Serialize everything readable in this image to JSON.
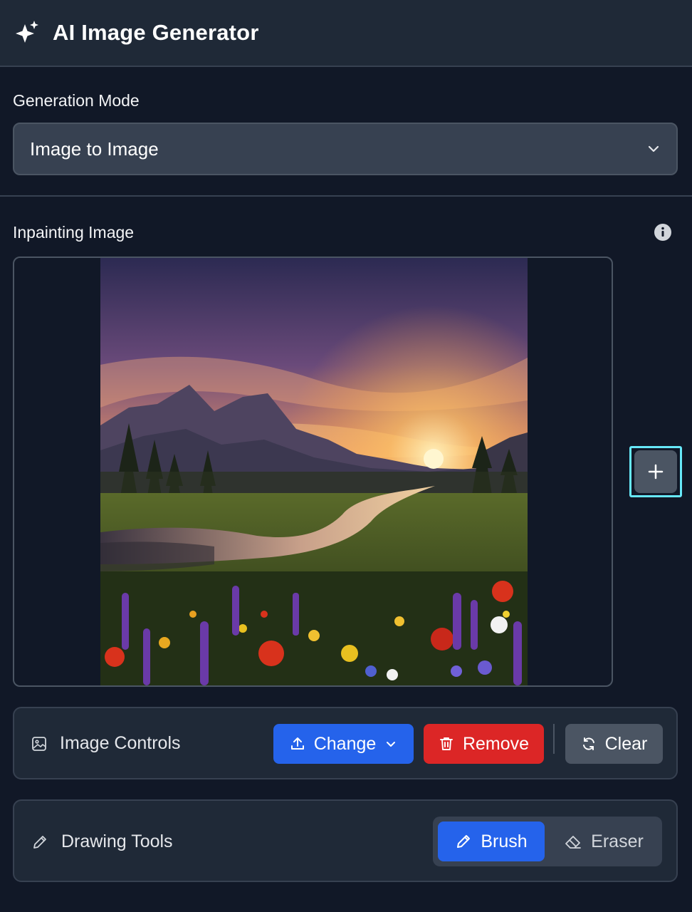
{
  "header": {
    "title": "AI Image Generator",
    "icon": "sparkles-icon"
  },
  "mode": {
    "label": "Generation Mode",
    "selected": "Image to Image"
  },
  "inpainting": {
    "label": "Inpainting Image"
  },
  "image_controls": {
    "title": "Image Controls",
    "change_label": "Change",
    "remove_label": "Remove",
    "clear_label": "Clear"
  },
  "drawing_tools": {
    "title": "Drawing Tools",
    "brush_label": "Brush",
    "eraser_label": "Eraser",
    "active_tool": "Brush"
  },
  "colors": {
    "background": "#111827",
    "panel": "#1f2937",
    "primary": "#2563eb",
    "danger": "#dc2626",
    "focus_ring": "#67e8f9"
  }
}
